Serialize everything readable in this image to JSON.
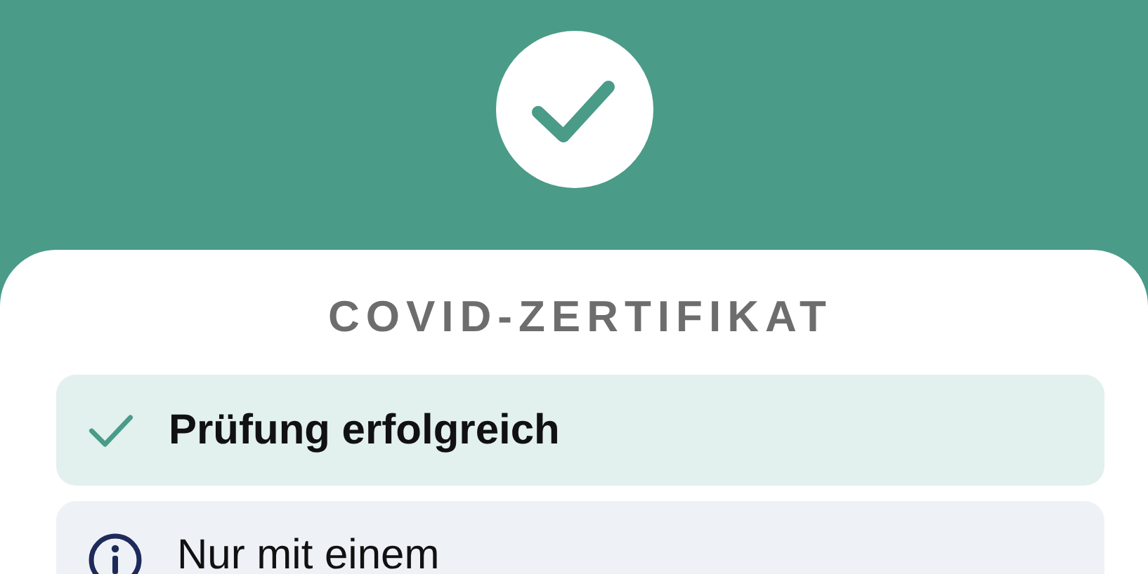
{
  "title": "COVID-ZERTIFIKAT",
  "messages": [
    {
      "kind": "success",
      "text": "Prüfung erfolgreich"
    },
    {
      "kind": "info",
      "text": "Nur mit einem"
    }
  ]
}
